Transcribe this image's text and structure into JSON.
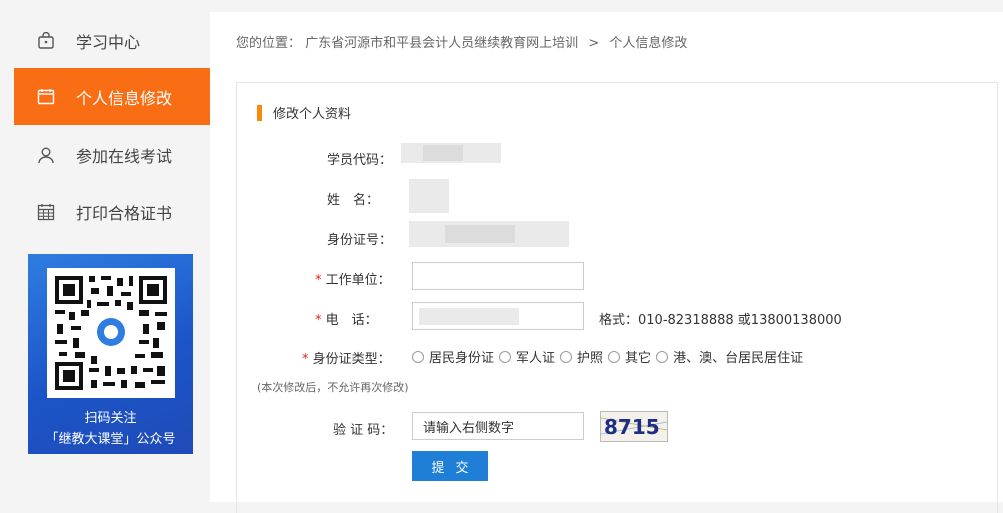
{
  "sidebar": {
    "items": [
      {
        "label": "学习中心",
        "icon": "lock-bag-icon",
        "active": false
      },
      {
        "label": "个人信息修改",
        "icon": "calendar-icon",
        "active": true
      },
      {
        "label": "参加在线考试",
        "icon": "user-icon",
        "active": false
      },
      {
        "label": "打印合格证书",
        "icon": "calendar-grid-icon",
        "active": false
      }
    ],
    "qr_caption_line1": "扫码关注",
    "qr_caption_line2": "「继教大课堂」公众号"
  },
  "breadcrumb": {
    "prefix": "您的位置：",
    "path1": "广东省河源市和平县会计人员继续教育网上培训",
    "separator": ">",
    "path2": "个人信息修改"
  },
  "form": {
    "title": "修改个人资料",
    "student_code_label": "学员代码：",
    "name_label": "姓　名：",
    "id_number_label": "身份证号：",
    "required_mark": "*",
    "workplace_label": "工作单位：",
    "workplace_value": "",
    "phone_label": "电　话：",
    "phone_format": "格式：010-82318888 或13800138000",
    "id_type_label": "身份证类型：",
    "id_type_options": [
      "居民身份证",
      "军人证",
      "护照",
      "其它",
      "港、澳、台居民居住证"
    ],
    "note": "(本次修改后，不允许再次修改)",
    "captcha_label": "验 证 码：",
    "captcha_placeholder": "请输入右侧数字",
    "captcha_value": "8715",
    "submit_label": "提交"
  },
  "colors": {
    "accent_orange": "#f96d15",
    "submit_blue": "#1f7fd6",
    "qr_blue": "#1c55c7"
  }
}
